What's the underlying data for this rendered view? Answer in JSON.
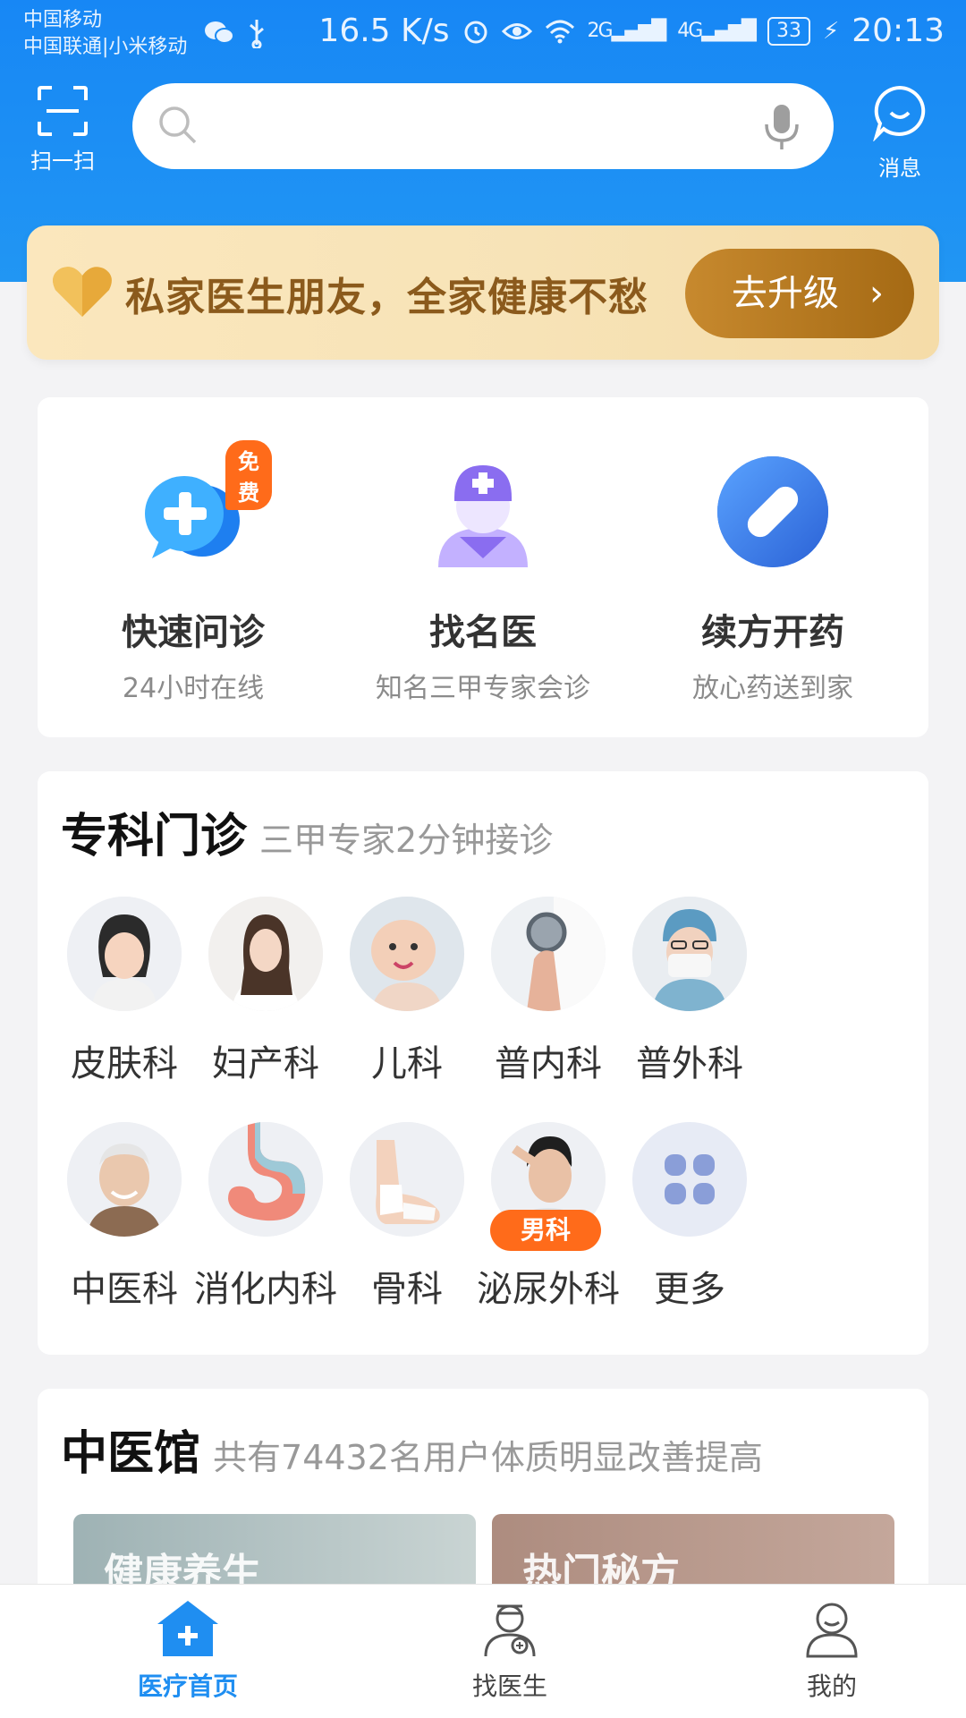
{
  "status_bar": {
    "carrier1": "中国移动",
    "carrier2": "中国联通|小米移动",
    "speed": "16.5 K/s",
    "net_2g": "2G",
    "net_4g": "4G",
    "battery": "33",
    "time": "20:13"
  },
  "header": {
    "scan_label": "扫一扫",
    "search_placeholder": "",
    "message_label": "消息"
  },
  "promo": {
    "text": "私家医生朋友，全家健康不愁",
    "button_label": "去升级",
    "button_chevron": "›"
  },
  "services": [
    {
      "title": "快速问诊",
      "subtitle": "24小时在线",
      "badge": "免费",
      "icon": "chat-plus-icon"
    },
    {
      "title": "找名医",
      "subtitle": "知名三甲专家会诊",
      "icon": "doctor-icon"
    },
    {
      "title": "续方开药",
      "subtitle": "放心药送到家",
      "icon": "pill-icon"
    }
  ],
  "specialty": {
    "title": "专科门诊",
    "subtitle": "三甲专家2分钟接诊",
    "departments": [
      {
        "label": "皮肤科"
      },
      {
        "label": "妇产科"
      },
      {
        "label": "儿科"
      },
      {
        "label": "普内科"
      },
      {
        "label": "普外科"
      },
      {
        "label": "中医科"
      },
      {
        "label": "消化内科"
      },
      {
        "label": "骨科"
      },
      {
        "label": "泌尿外科",
        "badge": "男科"
      },
      {
        "label": "更多"
      }
    ]
  },
  "tcm": {
    "title": "中医馆",
    "subtitle": "共有74432名用户体质明显改善提高",
    "cards": [
      {
        "label": "健康养生"
      },
      {
        "label": "热门秘方"
      }
    ]
  },
  "bottom_nav": [
    {
      "label": "医疗首页",
      "active": true
    },
    {
      "label": "找医生",
      "active": false
    },
    {
      "label": "我的",
      "active": false
    }
  ],
  "colors": {
    "primary": "#1f8ef1",
    "promo_gold": "#a56a14",
    "badge_orange": "#ff6b1a"
  }
}
